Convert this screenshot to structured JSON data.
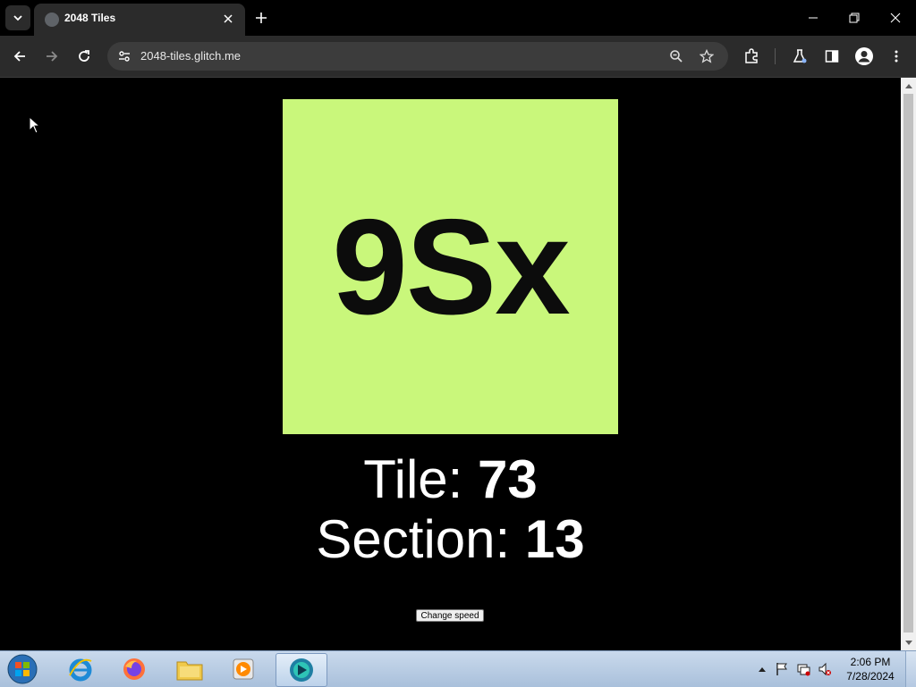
{
  "browser": {
    "tab_title": "2048 Tiles",
    "url": "2048-tiles.glitch.me"
  },
  "page": {
    "tile_text": "9Sx",
    "tile_color": "#c9f77b",
    "tile_label": "Tile: ",
    "tile_value": "73",
    "section_label": "Section: ",
    "section_value": "13",
    "speed_button_label": "Change speed"
  },
  "taskbar": {
    "time": "2:06 PM",
    "date": "7/28/2024",
    "pinned": [
      "internet-explorer-icon",
      "firefox-icon",
      "file-explorer-icon",
      "media-player-icon",
      "browser-app-icon"
    ]
  }
}
